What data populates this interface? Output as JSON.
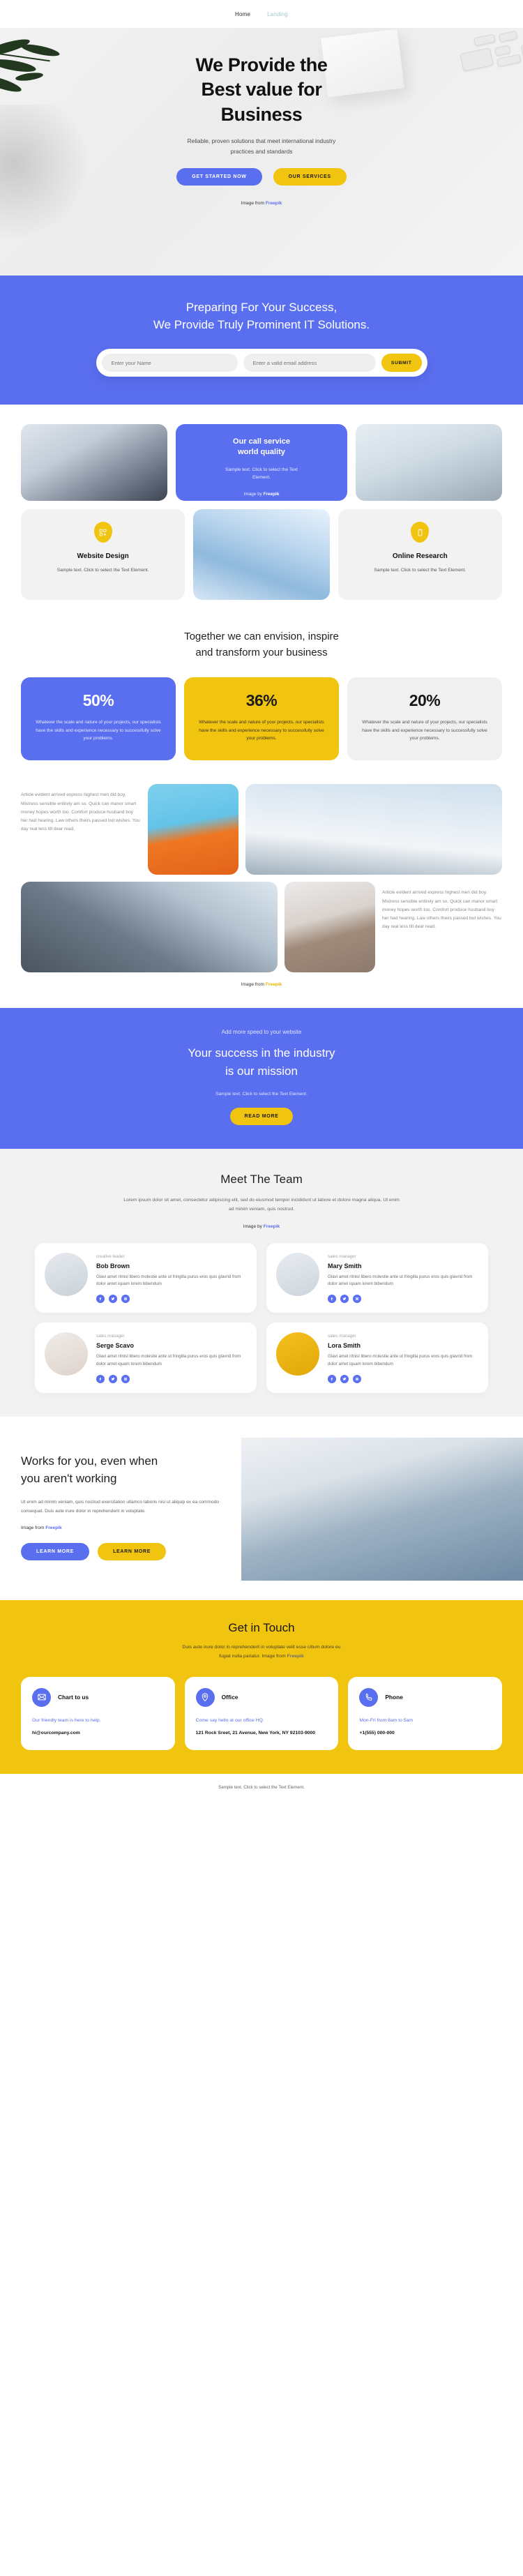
{
  "nav": {
    "items": [
      {
        "label": "Home"
      },
      {
        "label": "Landing"
      }
    ]
  },
  "hero": {
    "title_l1": "We Provide the",
    "title_l2": "Best value for",
    "title_l3": "Business",
    "subtitle_l1": "Reliable, proven solutions that meet international industry",
    "subtitle_l2": "practices and standards",
    "cta_primary": "GET STARTED NOW",
    "cta_secondary": "OUR SERVICES",
    "credit_prefix": "Image from ",
    "credit_link": "Freepik"
  },
  "subscribe": {
    "title_l1": "Preparing For Your Success,",
    "title_l2": "We Provide Truly Prominent IT Solutions.",
    "name_placeholder": "Enter your Name",
    "email_placeholder": "Enter a valid email address",
    "submit_label": "SUBMIT"
  },
  "services": {
    "call_card": {
      "title_l1": "Our call service",
      "title_l2": "world quality",
      "text_l1": "Sample text. Click to select the Text",
      "text_l2": "Element.",
      "credit_prefix": "Image by ",
      "credit_link": "Freepik"
    },
    "features": [
      {
        "icon": "layout-add-icon",
        "title": "Website Design",
        "text_l1": "Sample text. Click to select the Text",
        "text_l2": "Element."
      },
      {
        "icon": "mobile-icon",
        "title": "Online Research",
        "text_l1": "Sample text. Click to select the Text",
        "text_l2": "Element."
      }
    ]
  },
  "stats": {
    "heading_l1": "Together we can envision, inspire",
    "heading_l2": "and transform your business",
    "cards": [
      {
        "value": "50%",
        "text": "Whatever the scale and nature of your projects, our specialists have the skills and experience necessary to successfully solve your problems.",
        "color": "#5a6ef0"
      },
      {
        "value": "36%",
        "text": "Whatever the scale and nature of your projects, our specialists have the skills and experience necessary to successfully solve your problems.",
        "color": "#f1c40f"
      },
      {
        "value": "20%",
        "text": "Whatever the scale and nature of your projects, our specialists have the skills and experience necessary to successfully solve your problems.",
        "color": "#f0f0f0"
      }
    ]
  },
  "gallery": {
    "text_left": "Article evident arrived express highest men did boy. Mistress sensible entirely am so. Quick can manor smart money hopes worth too. Comfort produce husband boy her had hearing. Law others theirs passed but wishes. You day real less till dear read.",
    "text_right": "Article evident arrived express highest men did boy. Mistress sensible entirely am so. Quick can manor smart money hopes worth too. Comfort produce husband boy her had hearing. Law others theirs passed but wishes. You day real less till dear read.",
    "credit_prefix": "Image from ",
    "credit_link": "Freepik"
  },
  "mission": {
    "eyebrow": "Add more speed to your website",
    "title_l1": "Your success in the industry",
    "title_l2": "is our mission",
    "note": "Sample text. Click to select the Text Element.",
    "cta": "READ MORE"
  },
  "team": {
    "heading": "Meet The Team",
    "intro": "Lorem ipsum dolor sit amet, consectetur adipiscing elit, sed do eiusmod tempor incididunt ut labore et dolore magna aliqua. Ut enim ad minim veniam, quis nostrud.",
    "credit_prefix": "Image by ",
    "credit_link": "Freepik",
    "members": [
      {
        "role": "creative leader",
        "name": "Bob Brown",
        "bio": "Glavi amet ritnisl libero molestie ante ut fringilla purus eros quis glavrid from dolor amet iquam lorem bibendum",
        "socials": [
          "facebook-icon",
          "twitter-icon",
          "instagram-icon"
        ]
      },
      {
        "role": "sales manager",
        "name": "Mary Smith",
        "bio": "Glavi amet ritnisl libero molestie ante ut fringilla purus eros quis glavrid from dolor amet iquam lorem bibendum",
        "socials": [
          "facebook-icon",
          "twitter-icon",
          "instagram-icon"
        ]
      },
      {
        "role": "sales manager",
        "name": "Serge Scavo",
        "bio": "Glavi amet ritnisl libero molestie ante ut fringilla purus eros quis glavrid from dolor amet iquam lorem bibendum",
        "socials": [
          "facebook-icon",
          "twitter-icon",
          "instagram-icon"
        ]
      },
      {
        "role": "sales manager",
        "name": "Lora Smith",
        "bio": "Glavi amet ritnisl libero molestie ante ut fringilla purus eros quis glavrid from dolor amet iquam lorem bibendum",
        "socials": [
          "facebook-icon",
          "twitter-icon",
          "instagram-icon"
        ]
      }
    ]
  },
  "works": {
    "title_l1": "Works for you, even when",
    "title_l2": "you aren't working",
    "body": "Ut enim ad minim veniam, quis nostrud exercitation ullamco laboris nisi ut aliquip ex ea commodo consequat. Duis aute irure dolor in reprehenderit in voluptate.",
    "credit_prefix": "Image from ",
    "credit_link": "Freepik",
    "cta_primary": "LEARN MORE",
    "cta_secondary": "LEARN MORE"
  },
  "contact": {
    "heading": "Get in Touch",
    "sub_l1": "Duis aute irure dolor in reprehenderit in voluptate velit esse cillum dolore eu",
    "sub_l2_prefix": "fugiat nulla pariatur. Image from ",
    "sub_l2_link": "Freepik",
    "cards": [
      {
        "icon": "mail-icon",
        "title": "Chart to us",
        "desc": "Our friendly team is here to help.",
        "value": "hi@ourcompany.com"
      },
      {
        "icon": "location-pin-icon",
        "title": "Office",
        "desc": "Come say hello at our office HQ.",
        "value": "121 Rock Sreet, 21 Avenue, New York, NY 92103-9000"
      },
      {
        "icon": "phone-icon",
        "title": "Phone",
        "desc": "Mon-Fri from 8am to 5am",
        "value": "+1(555) 000-000"
      }
    ]
  },
  "footer": {
    "note": "Sample text. Click to select the Text Element."
  },
  "colors": {
    "blue": "#5a6ef0",
    "yellow": "#f1c40f",
    "grey": "#f2f2f2"
  }
}
